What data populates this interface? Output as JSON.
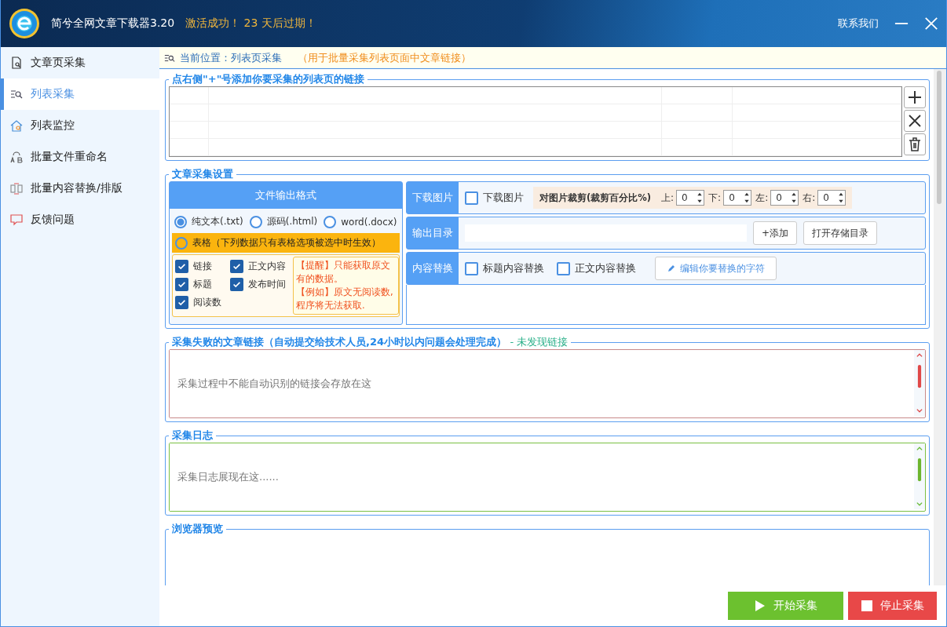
{
  "window": {
    "title": "简兮全网文章下载器3.20",
    "activation": "激活成功！  23 天后过期！",
    "contact": "联系我们"
  },
  "sidebar": {
    "items": [
      {
        "label": "文章页采集",
        "selected": false
      },
      {
        "label": "列表采集",
        "selected": true
      },
      {
        "label": "列表监控",
        "selected": false
      },
      {
        "label": "批量文件重命名",
        "selected": false
      },
      {
        "label": "批量内容替换/排版",
        "selected": false
      },
      {
        "label": "反馈问题",
        "selected": false
      }
    ]
  },
  "breadcrumb": {
    "label": "当前位置：列表页采集",
    "note": "（用于批量采集列表页面中文章链接）"
  },
  "link_list": {
    "legend": "点右侧\"+\"号添加你要采集的列表页的链接"
  },
  "settings": {
    "legend": "文章采集设置",
    "format": {
      "title": "文件输出格式",
      "options": [
        {
          "label": "纯文本(.txt)",
          "selected": true
        },
        {
          "label": "源码(.html)",
          "selected": false
        },
        {
          "label": "word(.docx)",
          "selected": false
        }
      ],
      "table_option": {
        "label": "表格（下列数据只有表格选项被选中时生效）",
        "selected": false
      },
      "fields": [
        {
          "label": "链接",
          "checked": true
        },
        {
          "label": "正文内容",
          "checked": true
        },
        {
          "label": "标题",
          "checked": true
        },
        {
          "label": "发布时间",
          "checked": true
        },
        {
          "label": "阅读数",
          "checked": true
        }
      ],
      "tips": [
        "【提醒】只能获取原文有的数据。",
        "【例如】原文无阅读数,程序将无法获取."
      ]
    },
    "download": {
      "label": "下载图片",
      "checkbox": {
        "label": "下载图片",
        "checked": false
      },
      "crop_label": "对图片裁剪(裁剪百分比%)",
      "crops": [
        {
          "label": "上:",
          "value": "0"
        },
        {
          "label": "下:",
          "value": "0"
        },
        {
          "label": "左:",
          "value": "0"
        },
        {
          "label": "右:",
          "value": "0"
        }
      ]
    },
    "output": {
      "label": "输出目录",
      "buttons": [
        "+添加",
        "打开存储目录"
      ]
    },
    "replace": {
      "label": "内容替换",
      "options": [
        {
          "label": "标题内容替换",
          "checked": false
        },
        {
          "label": "正文内容替换",
          "checked": false
        }
      ],
      "edit_button": "编辑你要替换的字符"
    }
  },
  "failed": {
    "legend": "采集失败的文章链接（自动提交给技术人员,24小时以内问题会处理完成）",
    "status": "- 未发现链接",
    "placeholder": "采集过程中不能自动识别的链接会存放在这"
  },
  "log": {
    "legend": "采集日志",
    "placeholder": "采集日志展现在这......"
  },
  "preview": {
    "legend": "浏览器预览"
  },
  "footer": {
    "start": "开始采集",
    "stop": "停止采集"
  }
}
